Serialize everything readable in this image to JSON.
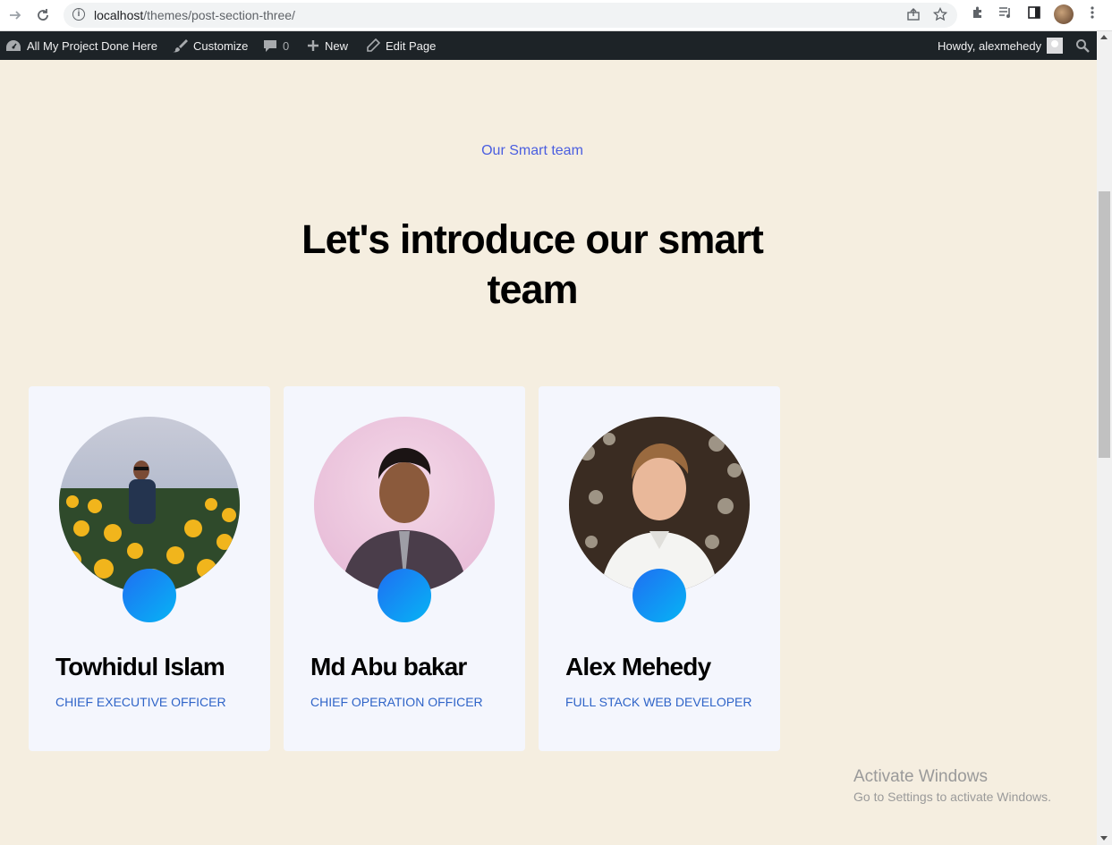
{
  "browser": {
    "url_host": "localhost",
    "url_path": "/themes/post-section-three/"
  },
  "adminbar": {
    "site_name": "All My Project Done Here",
    "customize": "Customize",
    "comments_count": "0",
    "new": "New",
    "edit_page": "Edit Page",
    "howdy": "Howdy, alexmehedy"
  },
  "section": {
    "eyebrow": "Our Smart team",
    "heading": "Let's introduce our smart team"
  },
  "team": [
    {
      "name": "Towhidul Islam",
      "role": "CHIEF EXECUTIVE OFFICER"
    },
    {
      "name": "Md Abu bakar",
      "role": "CHIEF OPERATION OFFICER"
    },
    {
      "name": "Alex Mehedy",
      "role": "FULL STACK WEB DEVELOPER"
    }
  ],
  "watermark": {
    "title": "Activate Windows",
    "subtitle": "Go to Settings to activate Windows."
  },
  "colors": {
    "page_bg": "#f5eee0",
    "accent": "#4a5ee0",
    "role": "#2f64c8",
    "card_bg": "#f4f6fd",
    "adminbar_bg": "#1d2327"
  }
}
